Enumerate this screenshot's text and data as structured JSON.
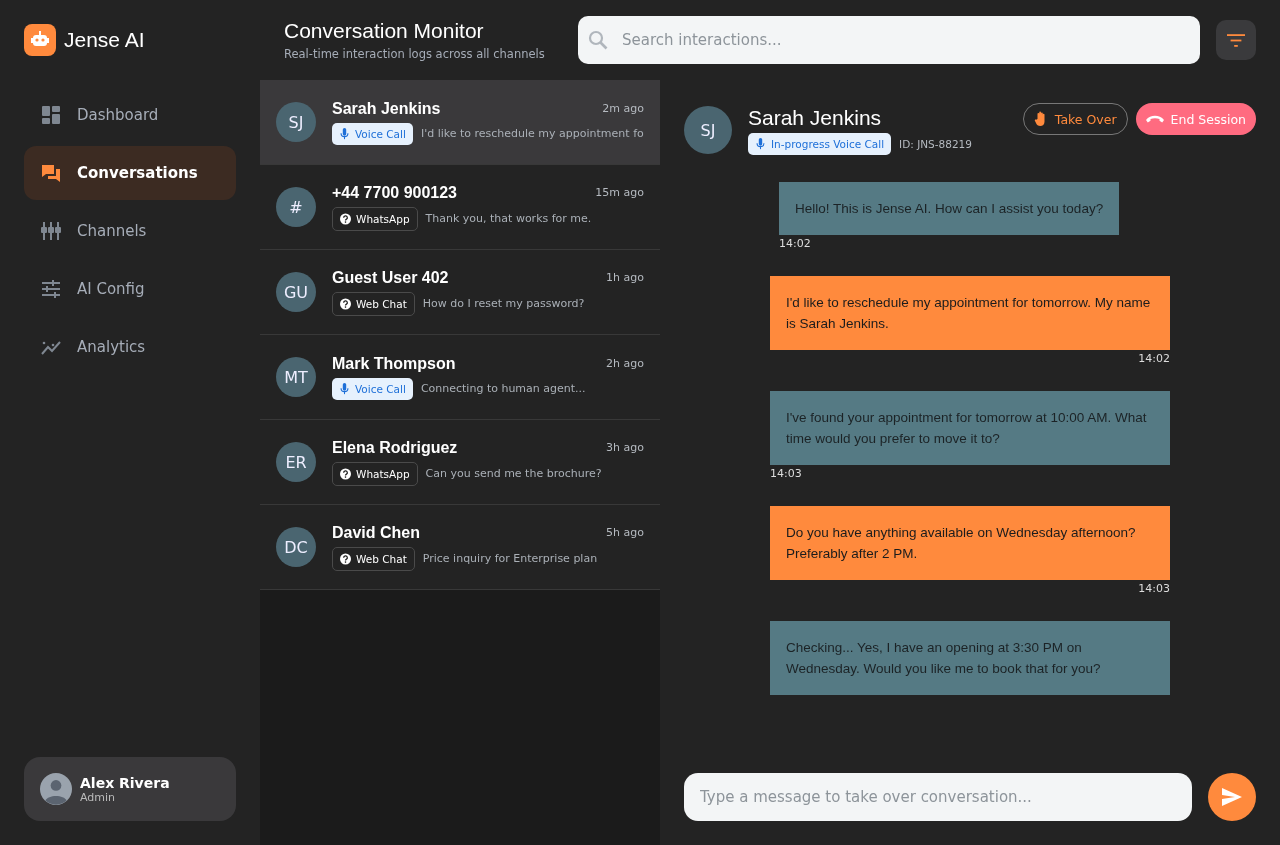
{
  "brand": {
    "name": "Jense AI"
  },
  "nav": [
    {
      "label": "Dashboard",
      "selected": false
    },
    {
      "label": "Conversations",
      "selected": true
    },
    {
      "label": "Channels",
      "selected": false
    },
    {
      "label": "AI Config",
      "selected": false
    },
    {
      "label": "Analytics",
      "selected": false
    }
  ],
  "user": {
    "name": "Alex Rivera",
    "role": "Admin"
  },
  "header": {
    "title": "Conversation Monitor",
    "subtitle": "Real-time interaction logs across all channels",
    "search_placeholder": "Search interactions..."
  },
  "conversations": [
    {
      "initials": "SJ",
      "name": "Sarah Jenkins",
      "time": "2m ago",
      "channel": "Voice Call",
      "kind": "voice",
      "preview": "I'd like to reschedule my appointment fo",
      "selected": true
    },
    {
      "initials": "#",
      "name": "+44 7700 900123",
      "time": "15m ago",
      "channel": "WhatsApp",
      "kind": "text",
      "preview": "Thank you, that works for me.",
      "selected": false
    },
    {
      "initials": "GU",
      "name": "Guest User 402",
      "time": "1h ago",
      "channel": "Web Chat",
      "kind": "text",
      "preview": "How do I reset my password?",
      "selected": false
    },
    {
      "initials": "MT",
      "name": "Mark Thompson",
      "time": "2h ago",
      "channel": "Voice Call",
      "kind": "voice",
      "preview": "Connecting to human agent...",
      "selected": false
    },
    {
      "initials": "ER",
      "name": "Elena Rodriguez",
      "time": "3h ago",
      "channel": "WhatsApp",
      "kind": "text",
      "preview": "Can you send me the brochure?",
      "selected": false
    },
    {
      "initials": "DC",
      "name": "David Chen",
      "time": "5h ago",
      "channel": "Web Chat",
      "kind": "text",
      "preview": "Price inquiry for Enterprise plan",
      "selected": false
    }
  ],
  "detail": {
    "initials": "SJ",
    "name": "Sarah Jenkins",
    "channel": "In-progress Voice Call",
    "id": "ID: JNS-88219",
    "take_over": "Take Over",
    "end_session": "End Session"
  },
  "messages": [
    {
      "kind": "ai",
      "text": "Hello! This is Jense AI. How can I assist you today?",
      "time": "14:02"
    },
    {
      "kind": "user",
      "text": "I'd like to reschedule my appointment for tomorrow. My name is Sarah Jenkins.",
      "time": "14:02"
    },
    {
      "kind": "ai",
      "text": "I've found your appointment for tomorrow at 10:00 AM. What time would you prefer to move it to?",
      "time": "14:03"
    },
    {
      "kind": "user",
      "text": "Do you have anything available on Wednesday afternoon? Preferably after 2 PM.",
      "time": "14:03"
    },
    {
      "kind": "ai",
      "text": "Checking... Yes, I have an opening at 3:30 PM on Wednesday. Would you like me to book that for you?"
    }
  ],
  "composer": {
    "placeholder": "Type a message to take over conversation..."
  }
}
